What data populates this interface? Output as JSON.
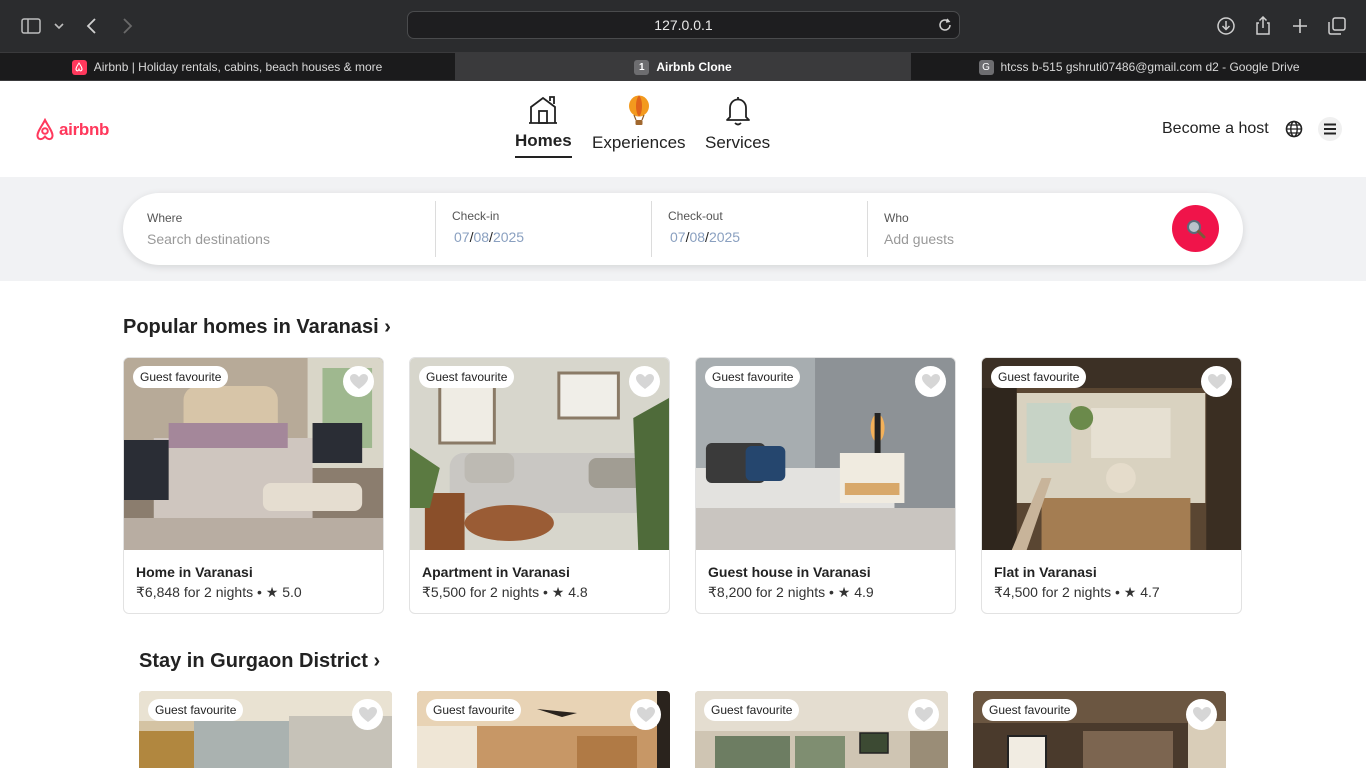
{
  "browser": {
    "address": "127.0.0.1",
    "tabs": [
      {
        "label": "Airbnb | Holiday rentals, cabins, beach houses & more",
        "favicon": "airbnb-icon"
      },
      {
        "label": "Airbnb Clone",
        "favicon_text": "1"
      },
      {
        "label": "htcss b-515 gshruti07486@gmail.com d2 - Google Drive",
        "favicon_text": "G"
      }
    ]
  },
  "header": {
    "logo_text": "airbnb",
    "brand_color": "#ff385c",
    "nav": [
      {
        "label": "Homes",
        "icon": "house-icon"
      },
      {
        "label": "Experiences",
        "icon": "balloon-icon"
      },
      {
        "label": "Services",
        "icon": "bell-icon"
      }
    ],
    "become_host": "Become a host"
  },
  "search": {
    "where": {
      "label": "Where",
      "placeholder": "Search destinations"
    },
    "checkin": {
      "label": "Check-in",
      "mm": "07",
      "dd": "08",
      "yyyy": "2025"
    },
    "checkout": {
      "label": "Check-out",
      "mm": "07",
      "dd": "08",
      "yyyy": "2025"
    },
    "who": {
      "label": "Who",
      "placeholder": "Add guests"
    }
  },
  "sections": [
    {
      "title": "Popular homes in Varanasi ›",
      "cards": [
        {
          "badge": "Guest favourite",
          "title": "Home in Varanasi",
          "meta": "₹6,848 for 2 nights • ★ 5.0"
        },
        {
          "badge": "Guest favourite",
          "title": "Apartment in Varanasi",
          "meta": "₹5,500 for 2 nights • ★ 4.8"
        },
        {
          "badge": "Guest favourite",
          "title": "Guest house in Varanasi",
          "meta": "₹8,200 for 2 nights • ★ 4.9"
        },
        {
          "badge": "Guest favourite",
          "title": "Flat in Varanasi",
          "meta": "₹4,500 for 2 nights • ★ 4.7"
        }
      ]
    },
    {
      "title": "Stay in Gurgaon District ›",
      "cards": [
        {
          "badge": "Guest favourite"
        },
        {
          "badge": "Guest favourite"
        },
        {
          "badge": "Guest favourite"
        },
        {
          "badge": "Guest favourite"
        }
      ]
    }
  ]
}
